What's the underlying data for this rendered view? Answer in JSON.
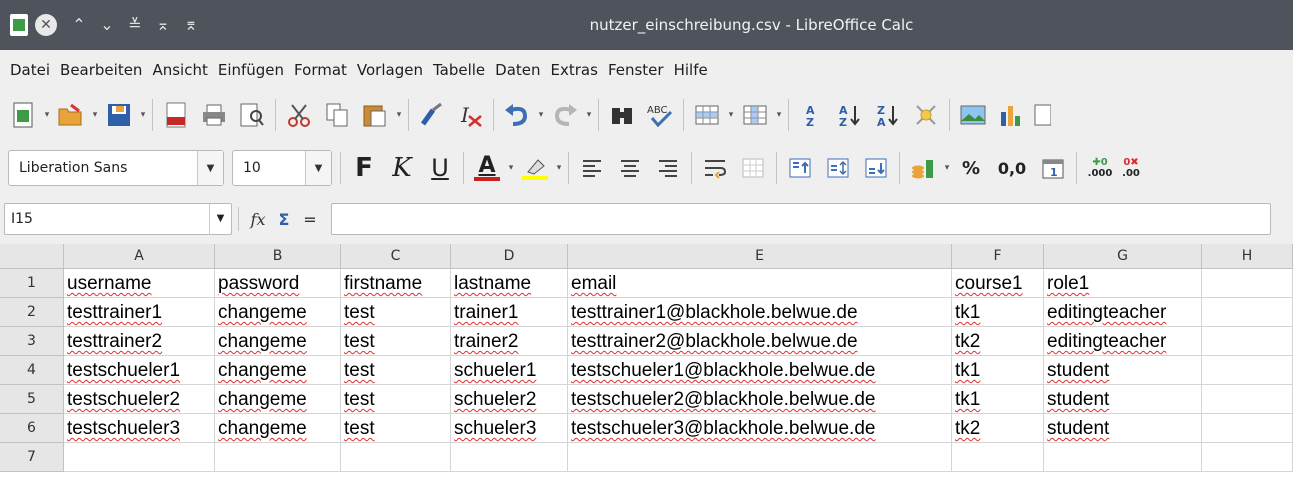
{
  "window": {
    "title": "nutzer_einschreibung.csv - LibreOffice Calc"
  },
  "menu": [
    "Datei",
    "Bearbeiten",
    "Ansicht",
    "Einfügen",
    "Format",
    "Vorlagen",
    "Tabelle",
    "Daten",
    "Extras",
    "Fenster",
    "Hilfe"
  ],
  "format_toolbar": {
    "font_name": "Liberation Sans",
    "font_size": "10",
    "bold_label": "F",
    "italic_label": "K",
    "underline_label": "U",
    "font_color_label": "A",
    "percent_label": "%",
    "number_label": "0,0",
    "calendar_label": "1"
  },
  "formula_bar": {
    "cell_ref": "I15",
    "function_label": "fx",
    "sum_label": "Σ",
    "equals_label": "=",
    "content": ""
  },
  "sheet": {
    "columns": [
      "A",
      "B",
      "C",
      "D",
      "E",
      "F",
      "G",
      "H"
    ],
    "rows": [
      "1",
      "2",
      "3",
      "4",
      "5",
      "6",
      "7"
    ],
    "cells": [
      [
        "username",
        "password",
        "firstname",
        "lastname",
        "email",
        "course1",
        "role1",
        ""
      ],
      [
        "testtrainer1",
        "changeme",
        "test",
        "trainer1",
        "testtrainer1@blackhole.belwue.de",
        "tk1",
        "editingteacher",
        ""
      ],
      [
        "testtrainer2",
        "changeme",
        "test",
        "trainer2",
        "testtrainer2@blackhole.belwue.de",
        "tk2",
        "editingteacher",
        ""
      ],
      [
        "testschueler1",
        "changeme",
        "test",
        "schueler1",
        "testschueler1@blackhole.belwue.de",
        "tk1",
        "student",
        ""
      ],
      [
        "testschueler2",
        "changeme",
        "test",
        "schueler2",
        "testschueler2@blackhole.belwue.de",
        "tk1",
        "student",
        ""
      ],
      [
        "testschueler3",
        "changeme",
        "test",
        "schueler3",
        "testschueler3@blackhole.belwue.de",
        "tk2",
        "student",
        ""
      ],
      [
        "",
        "",
        "",
        "",
        "",
        "",
        "",
        ""
      ]
    ]
  }
}
